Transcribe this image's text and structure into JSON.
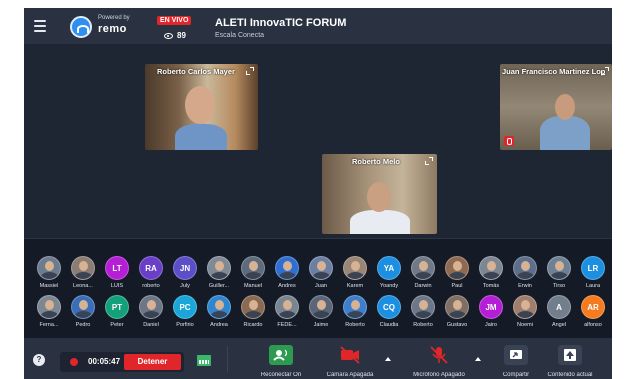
{
  "header": {
    "powered_by": "Powered by",
    "brand": "remo",
    "live_label": "EN VIVO",
    "viewer_count": "89",
    "event_title": "ALETI InnovaTIC FORUM",
    "event_subtitle": "Escala Conecta"
  },
  "stage": {
    "tiles": [
      {
        "name": "Roberto Carlos Mayer",
        "muted": false
      },
      {
        "name": "Juan Francisco Martinez Lop",
        "muted": true
      },
      {
        "name": "Roberto Melo",
        "muted": false
      }
    ]
  },
  "audience": {
    "row1": [
      {
        "name": "Massiel",
        "initials": "",
        "color": "#6d7b8f"
      },
      {
        "name": "Leona...",
        "initials": "",
        "color": "#8b7d74"
      },
      {
        "name": "LUIS",
        "initials": "LT",
        "color": "#b41fd6"
      },
      {
        "name": "roberto",
        "initials": "RA",
        "color": "#6a3fc8"
      },
      {
        "name": "July",
        "initials": "JN",
        "color": "#5b4fc8"
      },
      {
        "name": "Guiller...",
        "initials": "",
        "color": "#7f8a96"
      },
      {
        "name": "Manuel",
        "initials": "",
        "color": "#5e6b7c"
      },
      {
        "name": "Andres",
        "initials": "",
        "color": "#2f6fd2"
      },
      {
        "name": "Juan",
        "initials": "",
        "color": "#6c7fa3"
      },
      {
        "name": "Karem",
        "initials": "",
        "color": "#9a8576"
      },
      {
        "name": "Yoandy",
        "initials": "YA",
        "color": "#1d8fe1"
      },
      {
        "name": "Darwin",
        "initials": "",
        "color": "#6f7a86"
      },
      {
        "name": "Paul",
        "initials": "",
        "color": "#8f6a53"
      },
      {
        "name": "Tomás",
        "initials": "",
        "color": "#7d8794"
      },
      {
        "name": "Erwin",
        "initials": "",
        "color": "#5d6f8a"
      },
      {
        "name": "Tirso",
        "initials": "",
        "color": "#6e8096"
      },
      {
        "name": "Laura",
        "initials": "LR",
        "color": "#1d8fe1"
      }
    ],
    "row2": [
      {
        "name": "Ferna...",
        "initials": "",
        "color": "#7c8794"
      },
      {
        "name": "Pedro",
        "initials": "",
        "color": "#3a6fb8"
      },
      {
        "name": "Peter",
        "initials": "PT",
        "color": "#14a07a"
      },
      {
        "name": "Daniel",
        "initials": "",
        "color": "#6c7686"
      },
      {
        "name": "Porfirio",
        "initials": "PC",
        "color": "#1aa6d9"
      },
      {
        "name": "Andrea",
        "initials": "",
        "color": "#2f86d0"
      },
      {
        "name": "Ricardo",
        "initials": "",
        "color": "#8a6a52"
      },
      {
        "name": "FEDE...",
        "initials": "",
        "color": "#7a8592"
      },
      {
        "name": "Jaime",
        "initials": "",
        "color": "#5a6678"
      },
      {
        "name": "Roberto",
        "initials": "",
        "color": "#3d7fcc"
      },
      {
        "name": "Claudia",
        "initials": "CQ",
        "color": "#1d8fe1"
      },
      {
        "name": "Roberto",
        "initials": "",
        "color": "#6c7889"
      },
      {
        "name": "Gustavo",
        "initials": "",
        "color": "#7f6f64"
      },
      {
        "name": "Jairo",
        "initials": "JM",
        "color": "#b41fd6"
      },
      {
        "name": "Noemi",
        "initials": "",
        "color": "#a07e6e"
      },
      {
        "name": "Angel",
        "initials": "A",
        "color": "#737e8c"
      },
      {
        "name": "alfonso",
        "initials": "AR",
        "color": "#f47b20"
      }
    ]
  },
  "toolbar": {
    "help": "?",
    "rec_time": "00:05:47",
    "stop_label": "Detener",
    "reconnect_label": "Reconectar On",
    "camera_label": "Cámara Apagada",
    "mic_label": "Micrófono Apagado",
    "share_label": "Compartir",
    "content_label": "Contenido actual"
  },
  "colors": {
    "background": "#1f2633",
    "bar": "#2a3140",
    "live_red": "#e0262b",
    "accent_green": "#3ab86a"
  }
}
